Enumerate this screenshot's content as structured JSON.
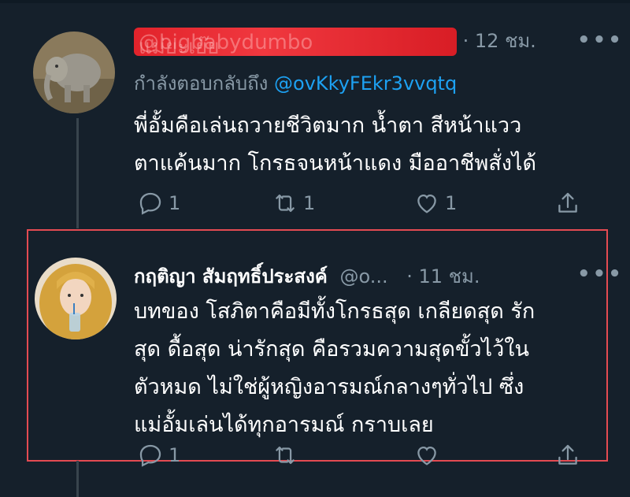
{
  "tweet1": {
    "display_name": "แม่ยะเย๊ย",
    "handle": "@bigbabydumbo",
    "time": "· 12 ชม.",
    "more": "•••",
    "reply_prefix": "กำลังตอบกลับถึง",
    "reply_to": "@ovKkyFEkr3vvqtq",
    "text_lines": [
      "พี่อั้มคือเล่นถวายชีวิตมาก น้ำตา สีหน้าแวว",
      "ตาแค้นมาก  โกรธจนหน้าแดง มืออาชีพสั่งได้"
    ],
    "reply_count": "1",
    "retweet_count": "1",
    "like_count": "1"
  },
  "tweet2": {
    "display_name": "กฤติญา สัมฤทธิ์ประสงค์",
    "handle": "@o...",
    "time": "· 11 ชม.",
    "more": "•••",
    "text_lines": [
      "บทของ โสภิตาคือมีทั้งโกรธสุด เกลียดสุด รัก",
      "สุด ดื้อสุด น่ารักสุด คือรวมความสุดขั้วไว้ใน",
      "ตัวหมด ไม่ใช่ผู้หญิงอารมณ์กลางๆทั่วไป ซึ่ง",
      "แม่อั้มเล่นได้ทุกอารมณ์ กราบเลย"
    ],
    "reply_count": "1"
  },
  "colors": {
    "background": "#15202b",
    "secondary_text": "#8899a6",
    "link": "#1da1f2",
    "highlight_border": "#e44b52",
    "redaction": "#e2232b"
  },
  "icons": {
    "reply": "reply-icon",
    "retweet": "retweet-icon",
    "like": "heart-icon",
    "share": "share-icon",
    "more": "more-icon"
  }
}
